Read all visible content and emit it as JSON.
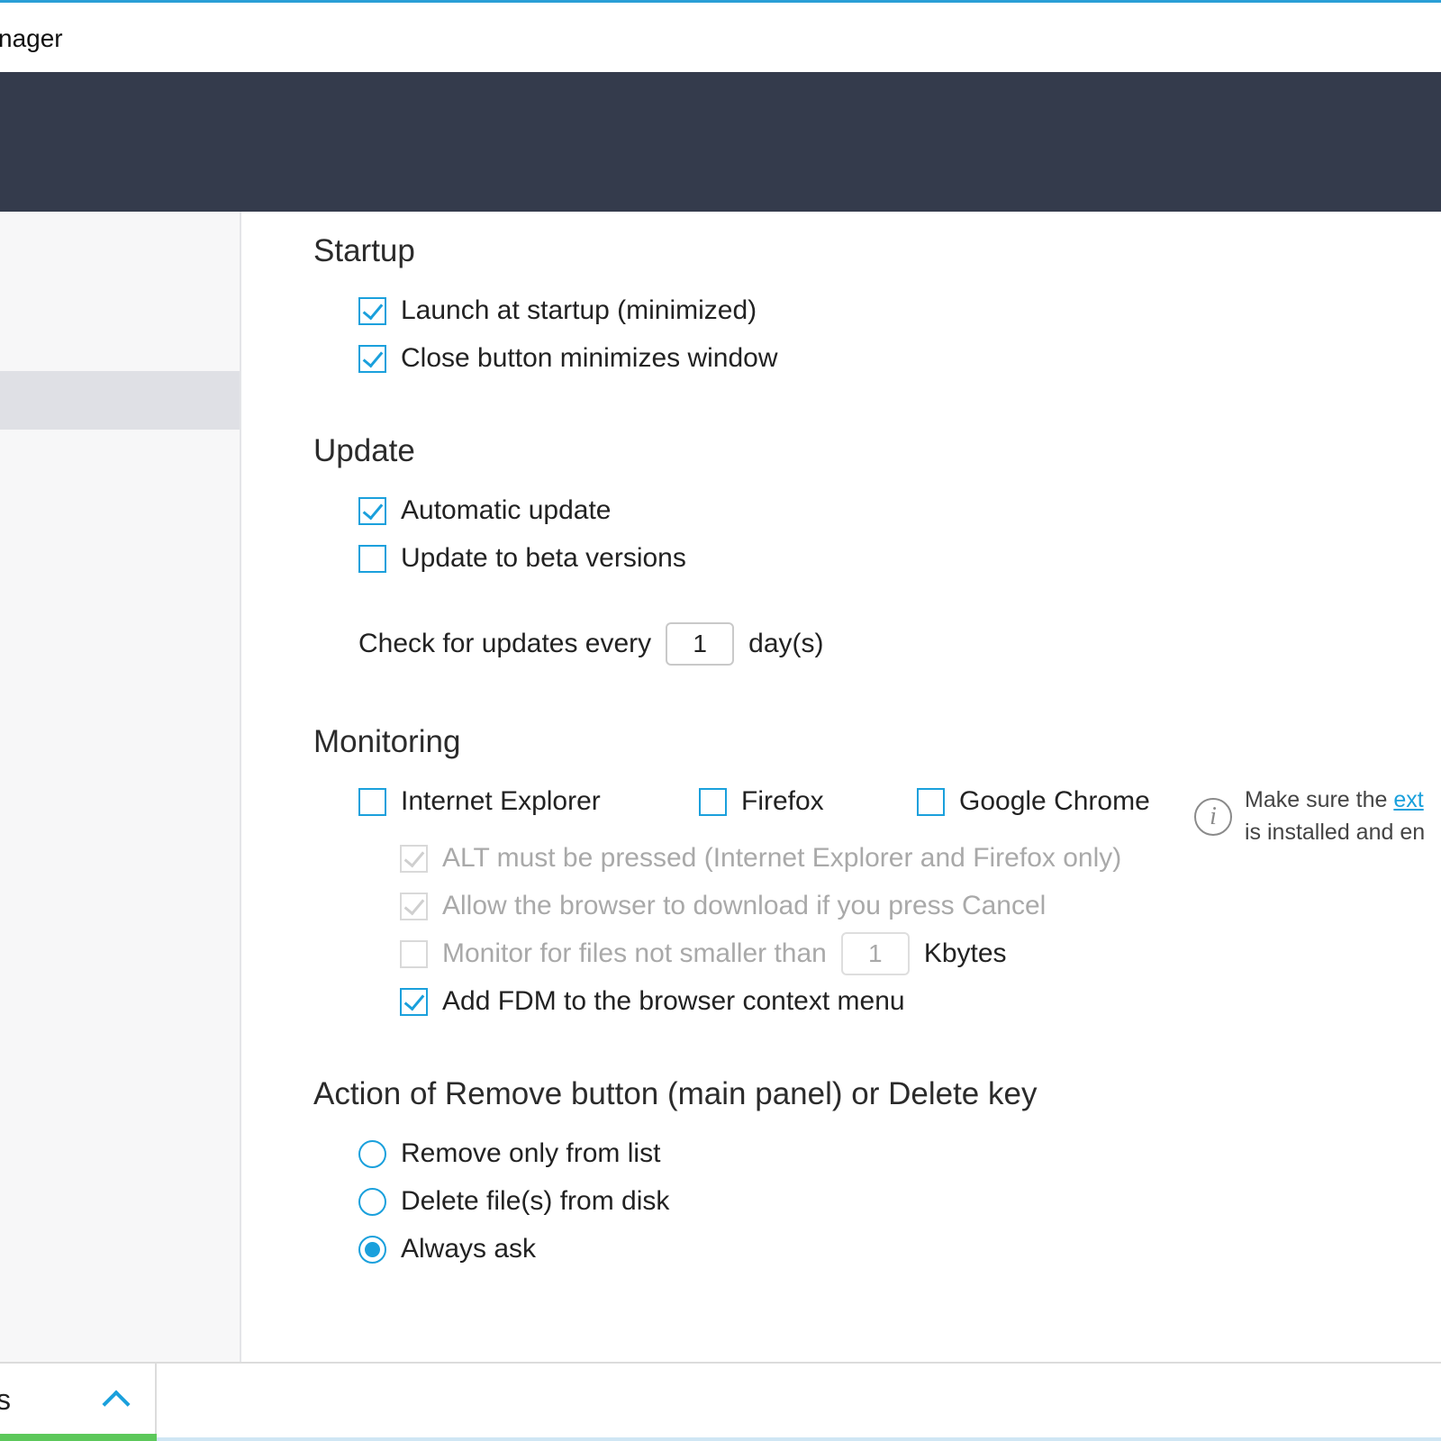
{
  "window": {
    "title_partial": "nager"
  },
  "settings": {
    "startup": {
      "title": "Startup",
      "launch_at_startup": {
        "label": "Launch at startup (minimized)",
        "checked": true
      },
      "close_minimizes": {
        "label": "Close button minimizes window",
        "checked": true
      }
    },
    "update": {
      "title": "Update",
      "automatic_update": {
        "label": "Automatic update",
        "checked": true
      },
      "beta_versions": {
        "label": "Update to beta versions",
        "checked": false
      },
      "check_prefix": "Check for updates every",
      "check_value": "1",
      "check_suffix": "day(s)"
    },
    "monitoring": {
      "title": "Monitoring",
      "browsers": [
        {
          "label": "Internet Explorer",
          "checked": false
        },
        {
          "label": "Firefox",
          "checked": false
        },
        {
          "label": "Google Chrome",
          "checked": false
        }
      ],
      "hint_line1_prefix": "Make sure the ",
      "hint_line1_link": "ext",
      "hint_line2": "is installed and en",
      "alt_pressed": {
        "label": "ALT must be pressed (Internet Explorer and Firefox only)",
        "checked": true,
        "enabled": false
      },
      "allow_cancel": {
        "label": "Allow the browser to download if you press Cancel",
        "checked": true,
        "enabled": false
      },
      "min_size": {
        "label": "Monitor for files not smaller than",
        "value": "1",
        "unit": "Kbytes",
        "checked": false,
        "enabled": false
      },
      "context_menu": {
        "label": "Add FDM to the browser context menu",
        "checked": true
      }
    },
    "remove_action": {
      "title": "Action of Remove button (main panel) or Delete key",
      "options": [
        {
          "label": "Remove only from list",
          "selected": false
        },
        {
          "label": "Delete file(s) from disk",
          "selected": false
        },
        {
          "label": "Always ask",
          "selected": true
        }
      ]
    }
  },
  "bottom_bar": {
    "tab_label_partial": "s"
  },
  "colors": {
    "accent": "#1aa0dc",
    "header": "#343b4c",
    "sidebar_selected": "#dfe0e5",
    "progress": "#5cc85a"
  }
}
